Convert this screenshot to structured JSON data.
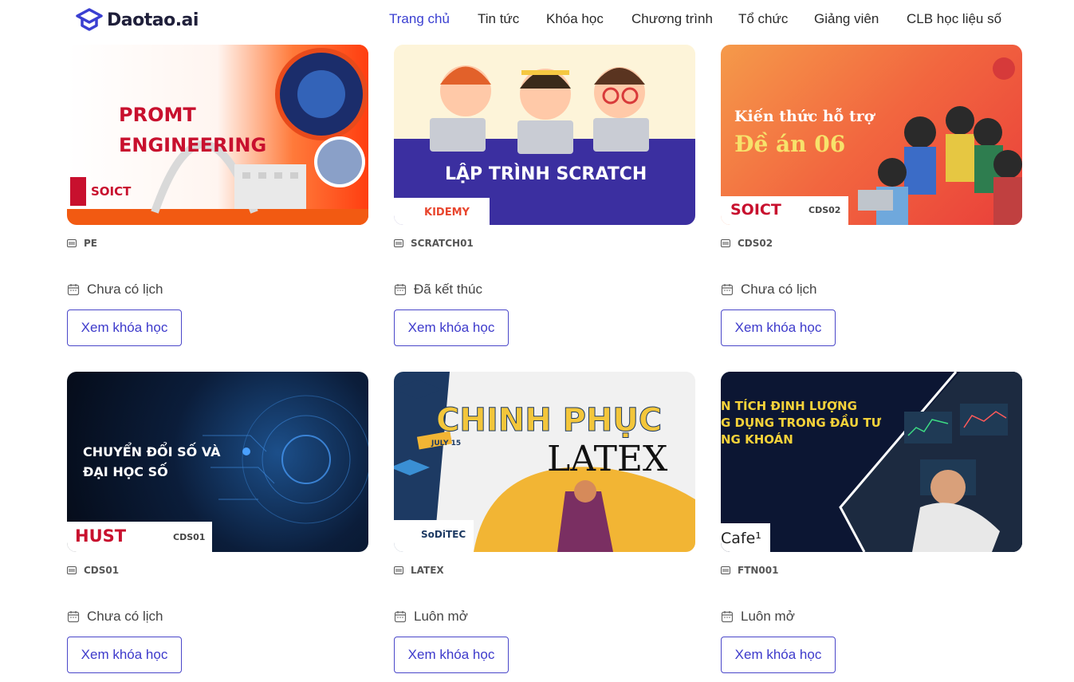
{
  "brand": {
    "name": "Daotao.ai",
    "accent": "#3a3fd1"
  },
  "nav": [
    {
      "label": "Trang chủ",
      "active": true
    },
    {
      "label": "Tin tức"
    },
    {
      "label": "Khóa học"
    },
    {
      "label": "Chương trình"
    },
    {
      "label": "Tổ chức"
    },
    {
      "label": "Giảng viên"
    },
    {
      "label": "CLB học liệu số"
    }
  ],
  "cards": [
    {
      "code": "PE",
      "schedule": "Chưa có lịch",
      "button": "Xem khóa học",
      "art": {
        "line1": "PROMT",
        "line2": "ENGINEERING",
        "badge": "SOICT"
      }
    },
    {
      "code": "SCRATCH01",
      "schedule": "Đã kết thúc",
      "button": "Xem khóa học",
      "art": {
        "title": "LẬP TRÌNH SCRATCH",
        "badge": "KIDEMY"
      }
    },
    {
      "code": "CDS02",
      "schedule": "Chưa có lịch",
      "button": "Xem khóa học",
      "art": {
        "line1": "Kiến thức hỗ trợ",
        "line2": "Đề án 06",
        "badge": "SOICT",
        "badge_code": "CDS02"
      }
    },
    {
      "code": "CDS01",
      "schedule": "Chưa có lịch",
      "button": "Xem khóa học",
      "art": {
        "line1": "CHUYỂN ĐỔI SỐ VÀ",
        "line2": "ĐẠI HỌC SỐ",
        "badge": "HUST",
        "badge_code": "CDS01"
      }
    },
    {
      "code": "LATEX",
      "schedule": "Luôn mở",
      "button": "Xem khóa học",
      "art": {
        "line1": "CHINH PHỤC",
        "line2": "LATEX",
        "ribbon": "JULY 15",
        "badge": "SoDiTEC"
      }
    },
    {
      "code": "FTN001",
      "schedule": "Luôn mở",
      "button": "Xem khóa học",
      "art": {
        "line1": "N TÍCH ĐỊNH LƯỢNG",
        "line2": "G DỤNG TRONG ĐẦU TƯ",
        "line3": "NG KHOÁN",
        "badge": "Cafe¹"
      }
    }
  ]
}
